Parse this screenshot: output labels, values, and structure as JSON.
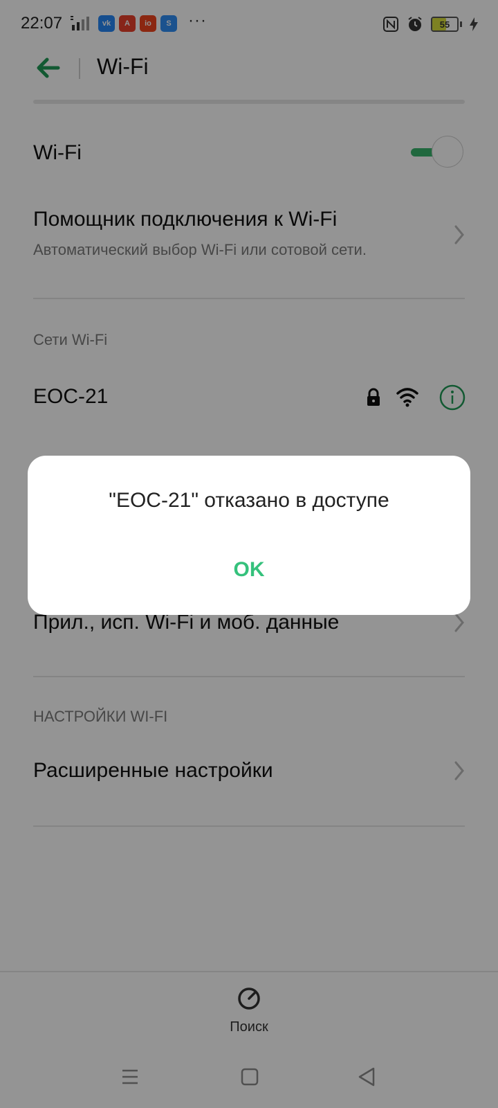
{
  "status_bar": {
    "time": "22:07",
    "apps": [
      {
        "icon": "vk-icon",
        "text": "vk",
        "color": "#2787f5"
      },
      {
        "icon": "aliexpress-icon",
        "text": "A",
        "color": "#e8412c"
      },
      {
        "icon": "io-icon",
        "text": "io",
        "color": "#f0441e"
      },
      {
        "icon": "shareit-icon",
        "text": "S",
        "color": "#2f8ef5"
      }
    ],
    "more": "···",
    "battery": "55",
    "battery_level": 0.55
  },
  "header": {
    "title": "Wi-Fi",
    "accent_color": "#1f9a56"
  },
  "wifi_toggle": {
    "label": "Wi-Fi",
    "on": true
  },
  "assistant": {
    "title": "Помощник подключения к Wi-Fi",
    "subtitle": "Автоматический выбор Wi-Fi или сотовой сети."
  },
  "networks": {
    "section_label": "Сети Wi-Fi",
    "items": [
      {
        "ssid": "EOC-21",
        "secured": true
      }
    ]
  },
  "apps_row": {
    "label": "Прил., исп. Wi-Fi и моб. данные"
  },
  "settings": {
    "section_label": "НАСТРОЙКИ WI-FI",
    "advanced_label": "Расширенные настройки"
  },
  "bottom": {
    "search_label": "Поиск"
  },
  "dialog": {
    "message": "\"EOC-21\" отказано в доступе",
    "ok_label": "OK",
    "ok_color": "#35c17c"
  }
}
